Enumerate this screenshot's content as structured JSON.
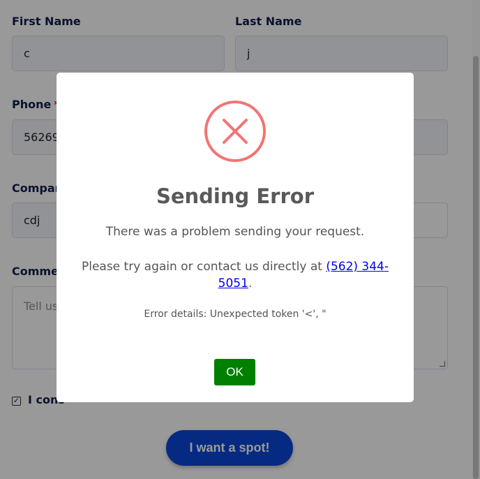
{
  "form": {
    "first_name_label": "First Name",
    "first_name_value": "c",
    "last_name_label": "Last Name",
    "last_name_value": "j",
    "phone_label": "Phone",
    "phone_required": "*",
    "phone_value": "56269",
    "company_label": "Compar",
    "company_value": "cdj",
    "comments_label": "Comme",
    "comments_placeholder": "Tell us",
    "consent_text": "I cons",
    "consent_checked": "✓",
    "submit_label": "I want a spot!"
  },
  "modal": {
    "title": "Sending Error",
    "message": "There was a problem sending your request.",
    "contact_prefix": "Please try again or contact us directly at ",
    "phone_link": "(562) 344-5051",
    "contact_suffix": ".",
    "error_details": "Error details: Unexpected token '<', \"",
    "ok_label": "OK",
    "icon": "error-x-icon"
  },
  "colors": {
    "error_icon": "#f27474",
    "ok_button": "#008000",
    "submit_button": "#0b47d9",
    "label_text": "#0f1f4d"
  }
}
